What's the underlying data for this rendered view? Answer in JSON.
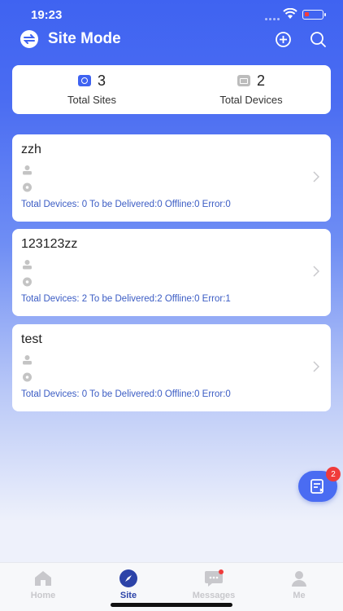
{
  "status_bar": {
    "time": "19:23"
  },
  "header": {
    "title": "Site Mode",
    "switch_icon": "swap-icon",
    "add_icon": "plus-circle-icon",
    "search_icon": "search-icon"
  },
  "summary": {
    "total_sites": {
      "value": "3",
      "label": "Total Sites"
    },
    "total_devices": {
      "value": "2",
      "label": "Total Devices"
    }
  },
  "sites": [
    {
      "name": "zzh",
      "stats": "Total Devices: 0 To be Delivered:0 Offline:0 Error:0"
    },
    {
      "name": "123123zz",
      "stats": "Total Devices: 2 To be Delivered:2 Offline:0 Error:1"
    },
    {
      "name": "test",
      "stats": "Total Devices: 0 To be Delivered:0 Offline:0 Error:0"
    }
  ],
  "fab": {
    "badge": "2"
  },
  "tabs": [
    {
      "label": "Home"
    },
    {
      "label": "Site"
    },
    {
      "label": "Messages"
    },
    {
      "label": "Me"
    }
  ],
  "colors": {
    "primary": "#3f63f1",
    "stats_text": "#3b5cc4",
    "badge": "#f03b3b",
    "active_tab": "#2c43a8"
  }
}
